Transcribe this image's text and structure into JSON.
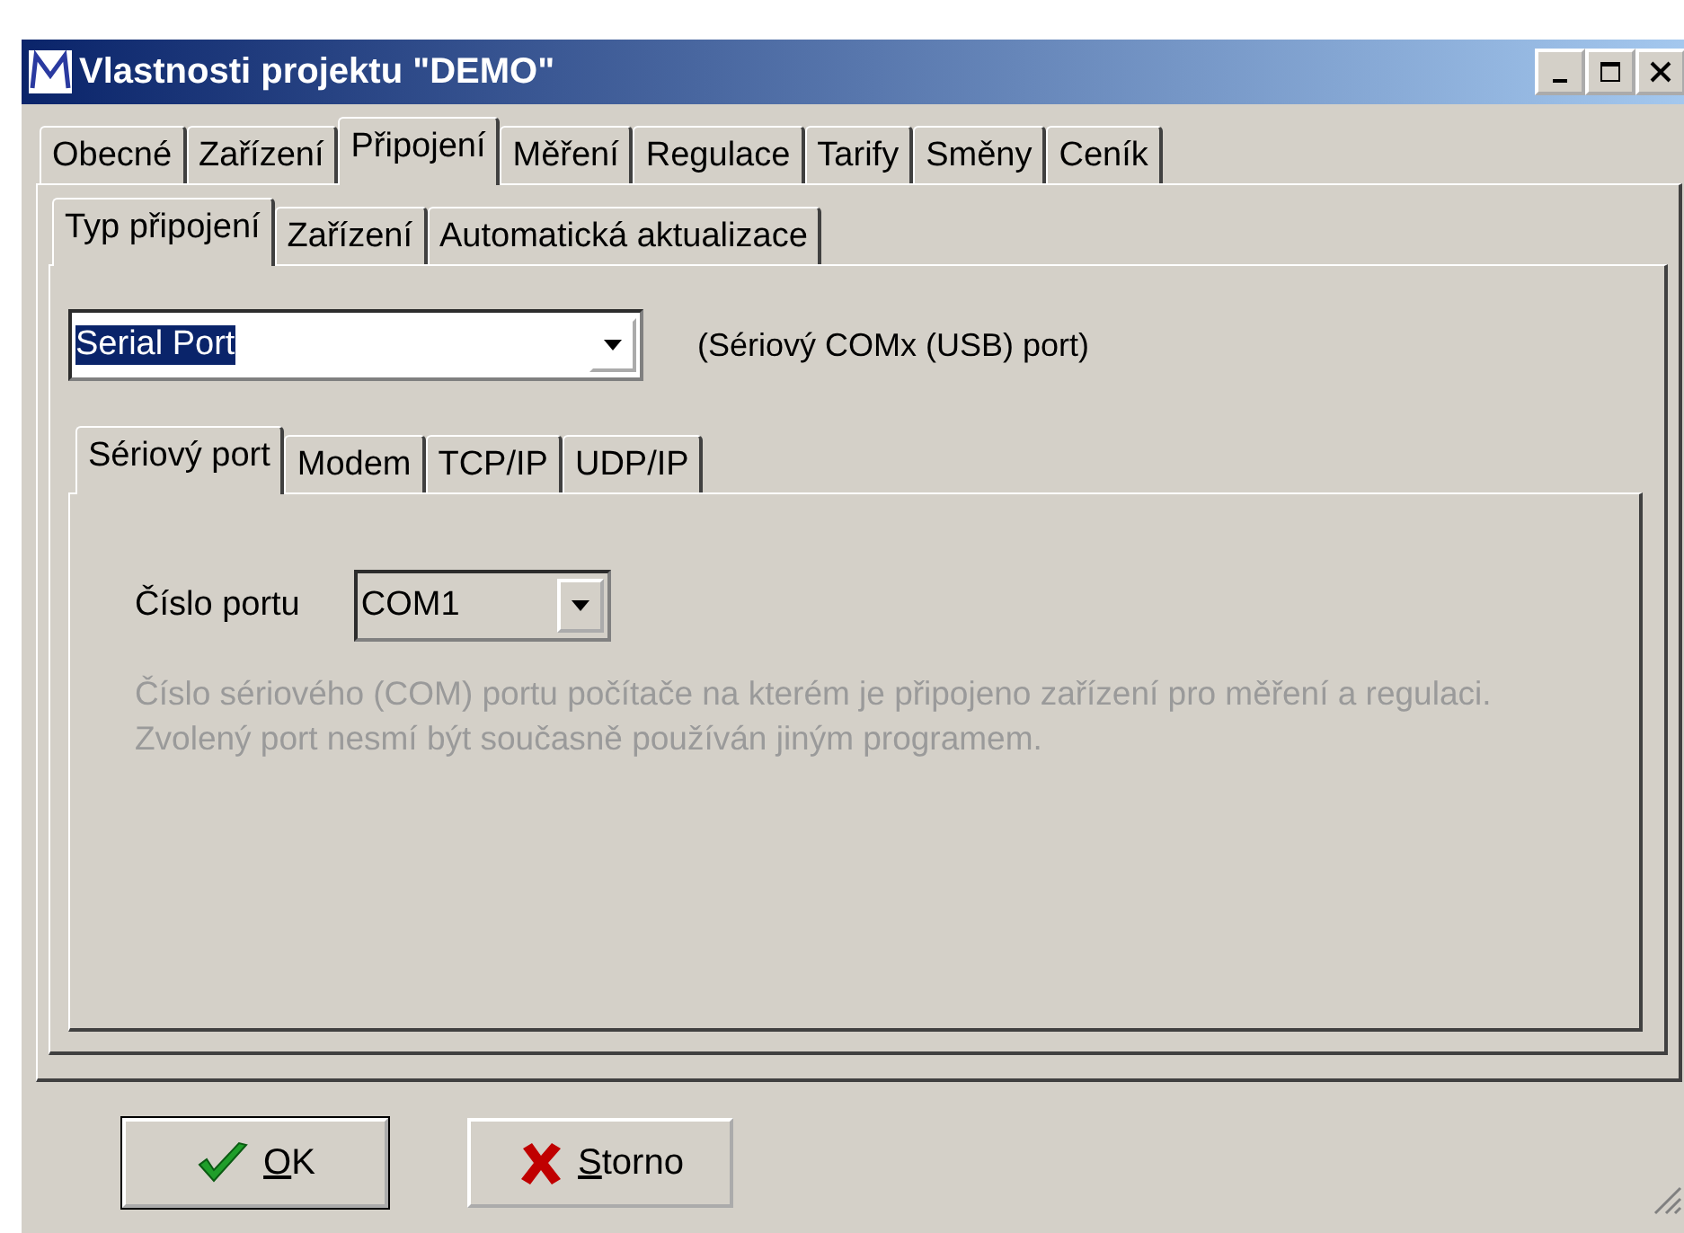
{
  "window": {
    "title": "Vlastnosti projektu \"DEMO\""
  },
  "tabs": [
    {
      "label": "Obecné",
      "selected": false
    },
    {
      "label": "Zařízení",
      "selected": false
    },
    {
      "label": "Připojení",
      "selected": true
    },
    {
      "label": "Měření",
      "selected": false
    },
    {
      "label": "Regulace",
      "selected": false
    },
    {
      "label": "Tarify",
      "selected": false
    },
    {
      "label": "Směny",
      "selected": false
    },
    {
      "label": "Ceník",
      "selected": false
    }
  ],
  "subtabs": [
    {
      "label": "Typ připojení",
      "selected": true
    },
    {
      "label": "Zařízení",
      "selected": false
    },
    {
      "label": "Automatická aktualizace",
      "selected": false
    }
  ],
  "connection_type": {
    "value": "Serial Port",
    "hint": "(Sériový COMx (USB) port)"
  },
  "port_tabs": [
    {
      "label": "Sériový port",
      "selected": true
    },
    {
      "label": "Modem",
      "selected": false
    },
    {
      "label": "TCP/IP",
      "selected": false
    },
    {
      "label": "UDP/IP",
      "selected": false
    }
  ],
  "port": {
    "label": "Číslo portu",
    "value": "COM1",
    "description": "Číslo sériového (COM) portu počítače na kterém je připojeno zařízení pro měření a regulaci. Zvolený port nesmí být současně používán jiným programem."
  },
  "buttons": [
    {
      "label": "OK",
      "kind": "ok"
    },
    {
      "label": "Storno",
      "kind": "cancel"
    }
  ]
}
